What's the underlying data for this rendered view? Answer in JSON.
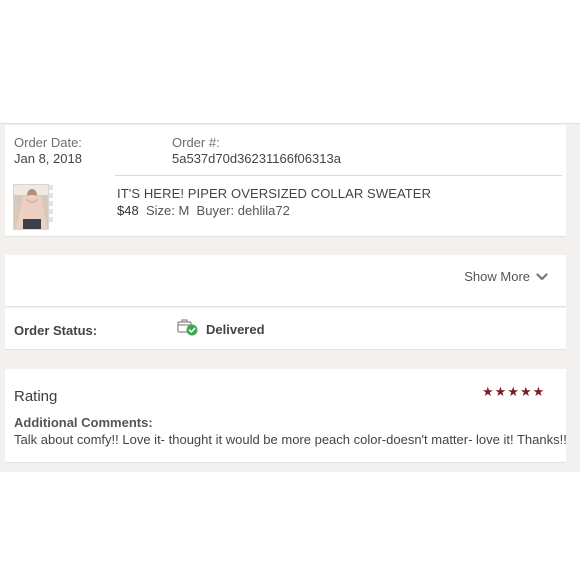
{
  "order": {
    "date_label": "Order Date:",
    "date_value": "Jan 8, 2018",
    "number_label": "Order #:",
    "number_value": "5a537d70d36231166f06313a"
  },
  "item": {
    "title": "IT'S HERE! PIPER OVERSIZED COLLAR SWEATER",
    "price": "$48",
    "size_label": "Size:",
    "size_value": "M",
    "buyer_label": "Buyer:",
    "buyer_value": "dehlila72"
  },
  "show_more": {
    "label": "Show More",
    "icon": "chevron-down-icon"
  },
  "status": {
    "label": "Order Status:",
    "value": "Delivered",
    "icon": "delivered-package-icon",
    "icon_color": "#3aa94b"
  },
  "rating": {
    "title": "Rating",
    "stars": 5,
    "star_color": "#7a1c2a",
    "comments_label": "Additional Comments:",
    "comments_text": "Talk about comfy!! Love it- thought it would be more peach color-doesn't matter- love it! Thanks!!"
  }
}
